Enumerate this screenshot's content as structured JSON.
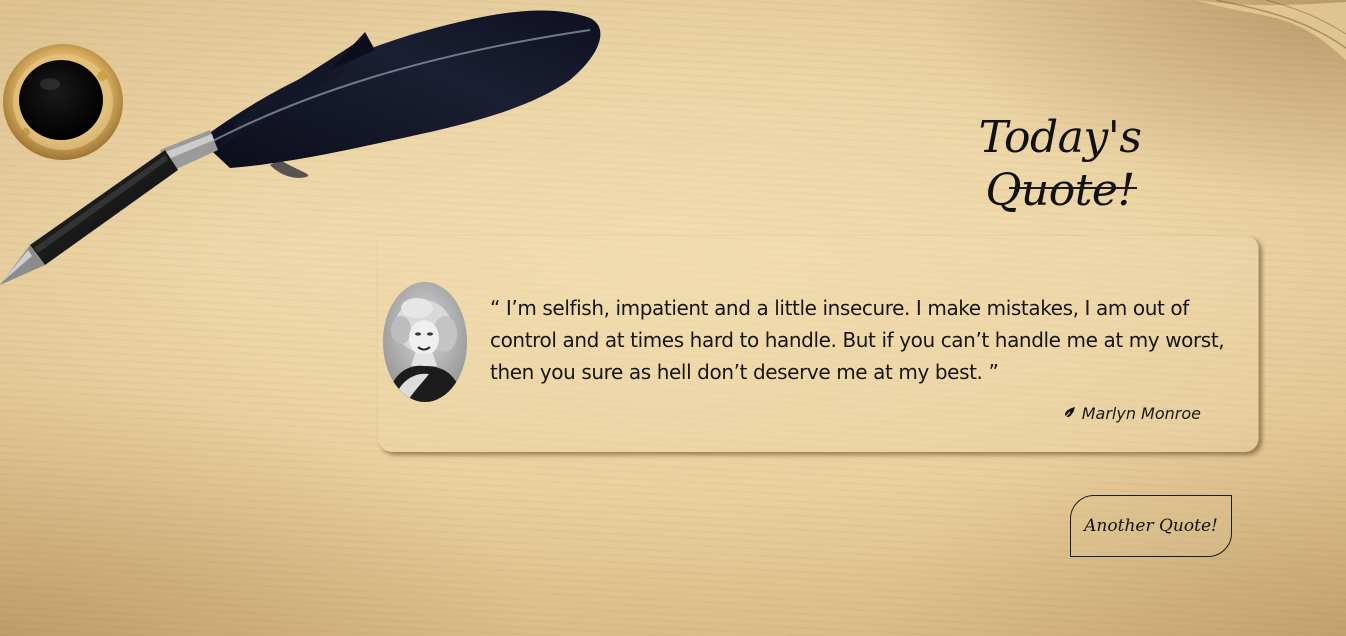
{
  "heading": {
    "title": "Today's Quote!"
  },
  "quote": {
    "text": "“ I’m selfish, impatient and a little insecure. I make mistakes, I am out of control and at times hard to handle. But if you can’t handle me at my worst, then you sure as hell don’t deserve me at my best. ”",
    "author": "Marlyn Monroe",
    "author_icon": "feather-icon"
  },
  "actions": {
    "another_quote_label": "Another Quote!"
  },
  "decor": {
    "quill_icon": "quill-pen-icon",
    "inkwell_icon": "inkwell-icon",
    "avatar_icon": "author-portrait"
  },
  "colors": {
    "text": "#161616",
    "parchment": "#e9d2a3",
    "ink": "#0d0f1c"
  }
}
